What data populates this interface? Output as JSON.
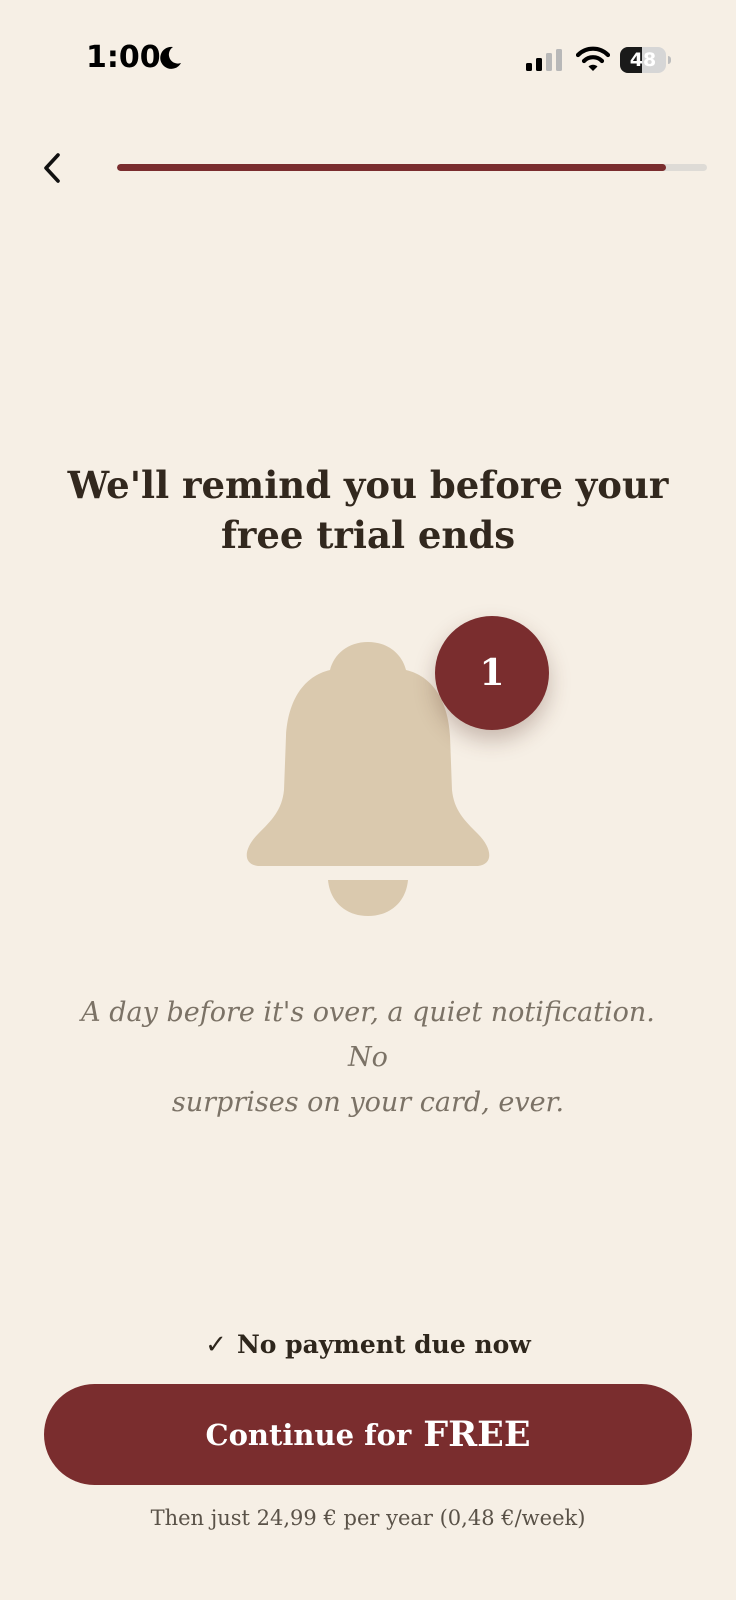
{
  "status_bar": {
    "time": "1:00",
    "battery_level": "48",
    "icons": [
      "moon-icon",
      "signal-icon",
      "wifi-icon",
      "battery-icon"
    ]
  },
  "nav": {
    "back_icon": "chevron-left-icon",
    "progress_fraction": 0.93
  },
  "main": {
    "headline_line1": "We'll remind you before your",
    "headline_line2": "free trial ends",
    "badge_count": "1",
    "bell_icon": "bell-icon",
    "description_line1": "A day before it's over, a quiet notification. No",
    "description_line2": "surprises on your card, ever."
  },
  "footer": {
    "check_icon": "check-icon",
    "no_payment_label": "No payment due now",
    "continue_label": "Continue for",
    "continue_emphasis": "FREE",
    "pricing_note": "Then just 24,99 € per year (0,48 €/week)"
  },
  "colors": {
    "background": "#f6efe5",
    "accent": "#7a2d2e",
    "bell": "#dac9ae",
    "text_dark": "#32281e",
    "text_muted": "#7b7266",
    "progress_track": "#dedbd6"
  }
}
